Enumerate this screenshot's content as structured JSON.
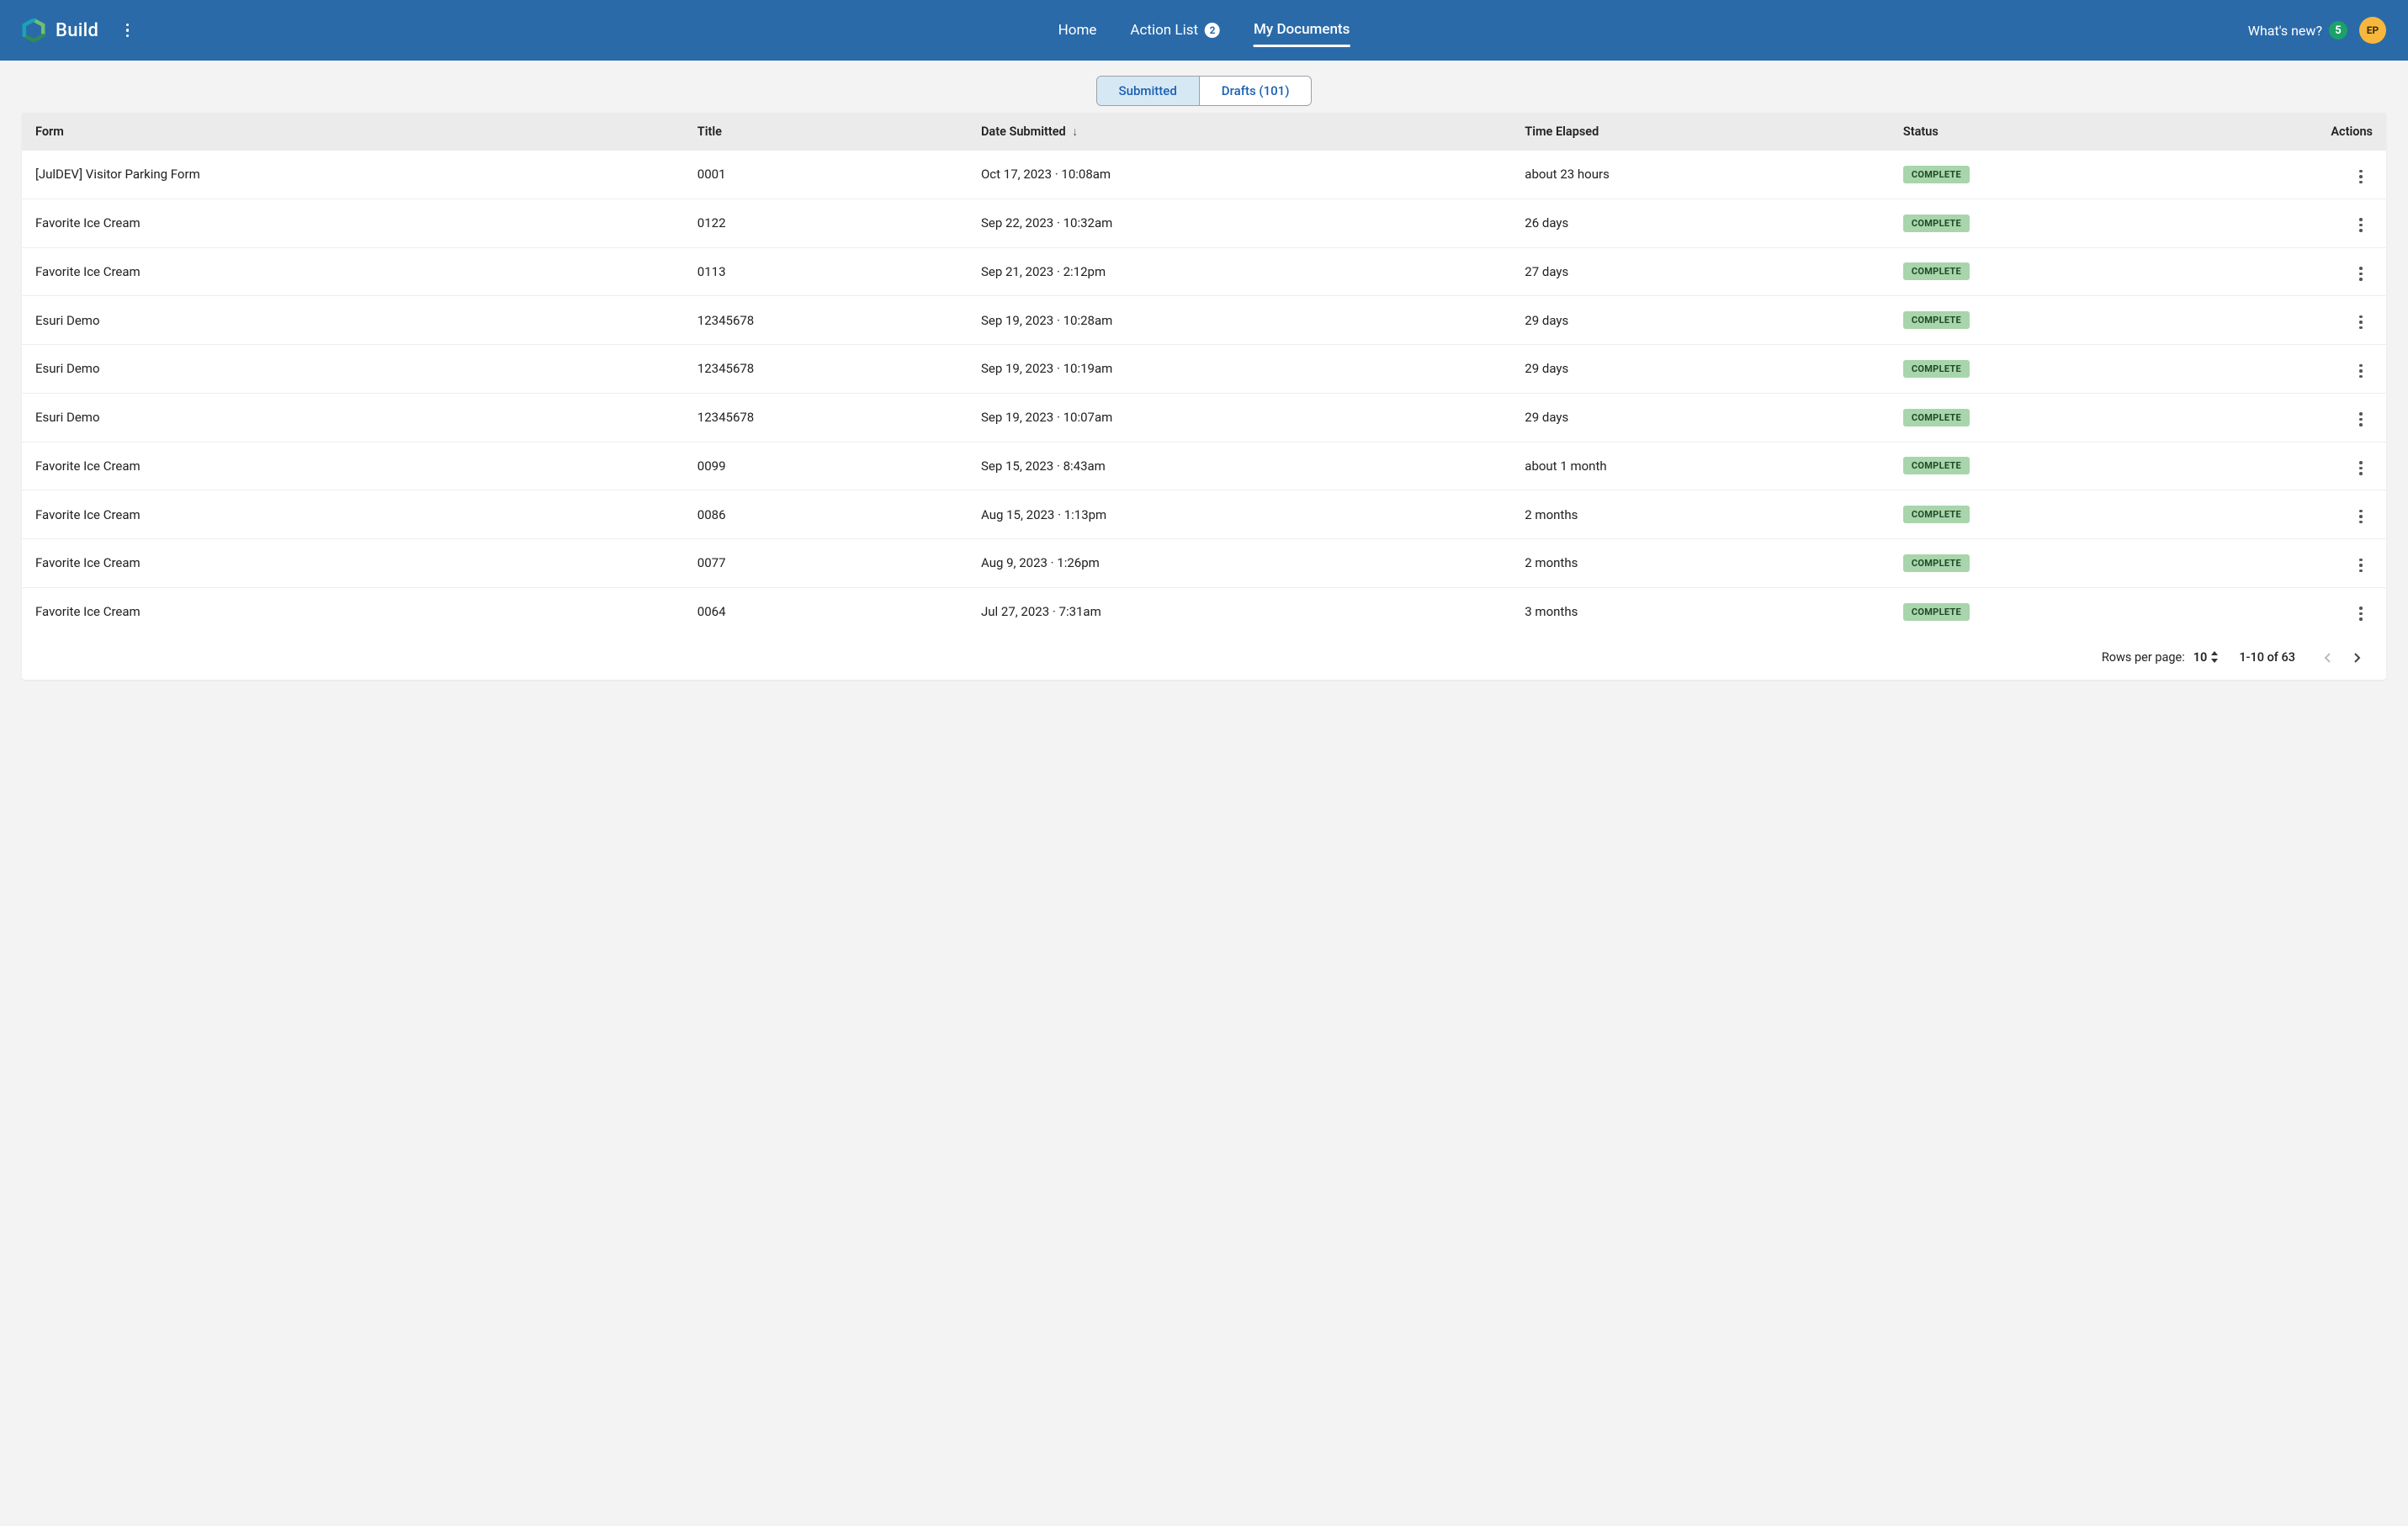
{
  "brand": {
    "name": "Build"
  },
  "nav": {
    "home": "Home",
    "action_list": "Action List",
    "action_badge": "2",
    "my_documents": "My Documents"
  },
  "topright": {
    "whats_new": "What's new?",
    "whats_new_badge": "5",
    "avatar_initials": "EP"
  },
  "tabs": {
    "submitted": "Submitted",
    "drafts": "Drafts (101)"
  },
  "columns": {
    "form": "Form",
    "title": "Title",
    "date": "Date Submitted",
    "elapsed": "Time Elapsed",
    "status": "Status",
    "actions": "Actions"
  },
  "rows": [
    {
      "form": "[JulDEV] Visitor Parking Form",
      "title": "0001",
      "date": "Oct 17, 2023 · 10:08am",
      "elapsed": "about 23 hours",
      "status": "COMPLETE"
    },
    {
      "form": "Favorite Ice Cream",
      "title": "0122",
      "date": "Sep 22, 2023 · 10:32am",
      "elapsed": "26 days",
      "status": "COMPLETE"
    },
    {
      "form": "Favorite Ice Cream",
      "title": "0113",
      "date": "Sep 21, 2023 · 2:12pm",
      "elapsed": "27 days",
      "status": "COMPLETE"
    },
    {
      "form": "Esuri Demo",
      "title": "12345678",
      "date": "Sep 19, 2023 · 10:28am",
      "elapsed": "29 days",
      "status": "COMPLETE"
    },
    {
      "form": "Esuri Demo",
      "title": "12345678",
      "date": "Sep 19, 2023 · 10:19am",
      "elapsed": "29 days",
      "status": "COMPLETE"
    },
    {
      "form": "Esuri Demo",
      "title": "12345678",
      "date": "Sep 19, 2023 · 10:07am",
      "elapsed": "29 days",
      "status": "COMPLETE"
    },
    {
      "form": "Favorite Ice Cream",
      "title": "0099",
      "date": "Sep 15, 2023 · 8:43am",
      "elapsed": "about 1 month",
      "status": "COMPLETE"
    },
    {
      "form": "Favorite Ice Cream",
      "title": "0086",
      "date": "Aug 15, 2023 · 1:13pm",
      "elapsed": "2 months",
      "status": "COMPLETE"
    },
    {
      "form": "Favorite Ice Cream",
      "title": "0077",
      "date": "Aug 9, 2023 · 1:26pm",
      "elapsed": "2 months",
      "status": "COMPLETE"
    },
    {
      "form": "Favorite Ice Cream",
      "title": "0064",
      "date": "Jul 27, 2023 · 7:31am",
      "elapsed": "3 months",
      "status": "COMPLETE"
    }
  ],
  "pagination": {
    "rows_per_page_label": "Rows per page:",
    "rows_per_page_value": "10",
    "range": "1-10 of 63"
  }
}
